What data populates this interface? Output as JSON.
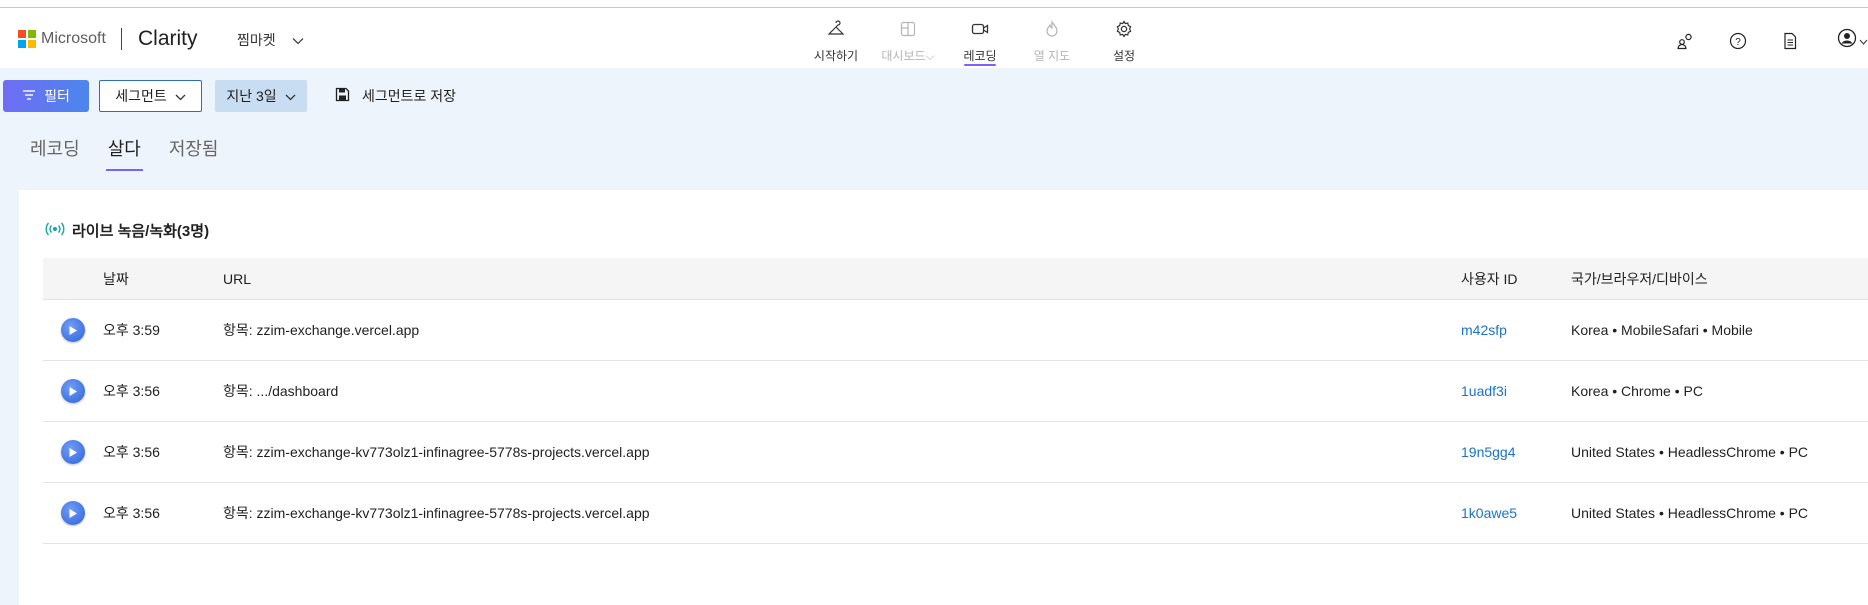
{
  "header": {
    "brand": "Microsoft",
    "product": "Clarity",
    "project": "찜마켓",
    "nav": [
      {
        "label": "시작하기",
        "icon": "hanger-icon",
        "state": "normal"
      },
      {
        "label": "대시보드",
        "icon": "dashboard-icon",
        "state": "disabled"
      },
      {
        "label": "레코딩",
        "icon": "video-camera-icon",
        "state": "active"
      },
      {
        "label": "열 지도",
        "icon": "flame-icon",
        "state": "disabled"
      },
      {
        "label": "설정",
        "icon": "gear-icon",
        "state": "normal"
      }
    ],
    "right_icons": [
      "people-icon",
      "help-icon",
      "document-icon",
      "account-icon"
    ]
  },
  "toolbar": {
    "filter_label": "필터",
    "segment_label": "세그먼트",
    "range_label": "지난 3일",
    "save_label": "세그먼트로 저장"
  },
  "tabs": [
    {
      "label": "레코딩",
      "active": false
    },
    {
      "label": "살다",
      "active": true
    },
    {
      "label": "저장됨",
      "active": false
    }
  ],
  "live": {
    "title": "라이브 녹음/녹화(3명)",
    "columns": {
      "date": "날짜",
      "url": "URL",
      "user_id": "사용자 ID",
      "env": "국가/브라우저/디바이스"
    },
    "rows": [
      {
        "date": "오후 3:59",
        "url": "항목: zzim-exchange.vercel.app",
        "user_id": "m42sfp",
        "env": "Korea • MobileSafari • Mobile"
      },
      {
        "date": "오후 3:56",
        "url": "항목: .../dashboard",
        "user_id": "1uadf3i",
        "env": "Korea • Chrome • PC"
      },
      {
        "date": "오후 3:56",
        "url": "항목: zzim-exchange-kv773olz1-infinagree-5778s-projects.vercel.app",
        "user_id": "19n5gg4",
        "env": "United States • HeadlessChrome • PC"
      },
      {
        "date": "오후 3:56",
        "url": "항목: zzim-exchange-kv773olz1-infinagree-5778s-projects.vercel.app",
        "user_id": "1k0awe5",
        "env": "United States • HeadlessChrome • PC"
      }
    ]
  },
  "colors": {
    "accent": "#7b61ff",
    "link": "#1a73c9",
    "filter_button": "#5a7df0",
    "live_icon": "#12a8a8"
  }
}
